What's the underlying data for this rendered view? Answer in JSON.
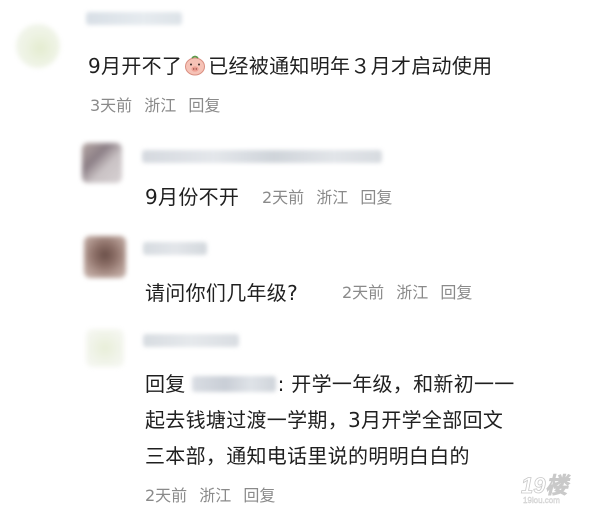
{
  "comments": [
    {
      "text_before_emoji": "9月开不了",
      "emoji": "piglet-face",
      "text_after_emoji": "已经被通知明年３月才启动使用",
      "meta": {
        "time": "3天前",
        "location": "浙江",
        "reply": "回复"
      }
    },
    {
      "text": "9月份不开",
      "meta": {
        "time": "2天前",
        "location": "浙江",
        "reply": "回复"
      }
    },
    {
      "text": "请问你们几年级?",
      "meta": {
        "time": "2天前",
        "location": "浙江",
        "reply": "回复"
      }
    },
    {
      "reply_prefix": "回复",
      "line1_rest": ": 开学一年级，和新初一一",
      "line2": "起去钱塘过渡一学期，3月开学全部回文",
      "line3": "三本部，通知电话里说的明明白白的",
      "meta": {
        "time": "2天前",
        "location": "浙江",
        "reply": "回复"
      }
    }
  ],
  "watermark": {
    "text": "19楼",
    "subtext": "19lou.com"
  }
}
